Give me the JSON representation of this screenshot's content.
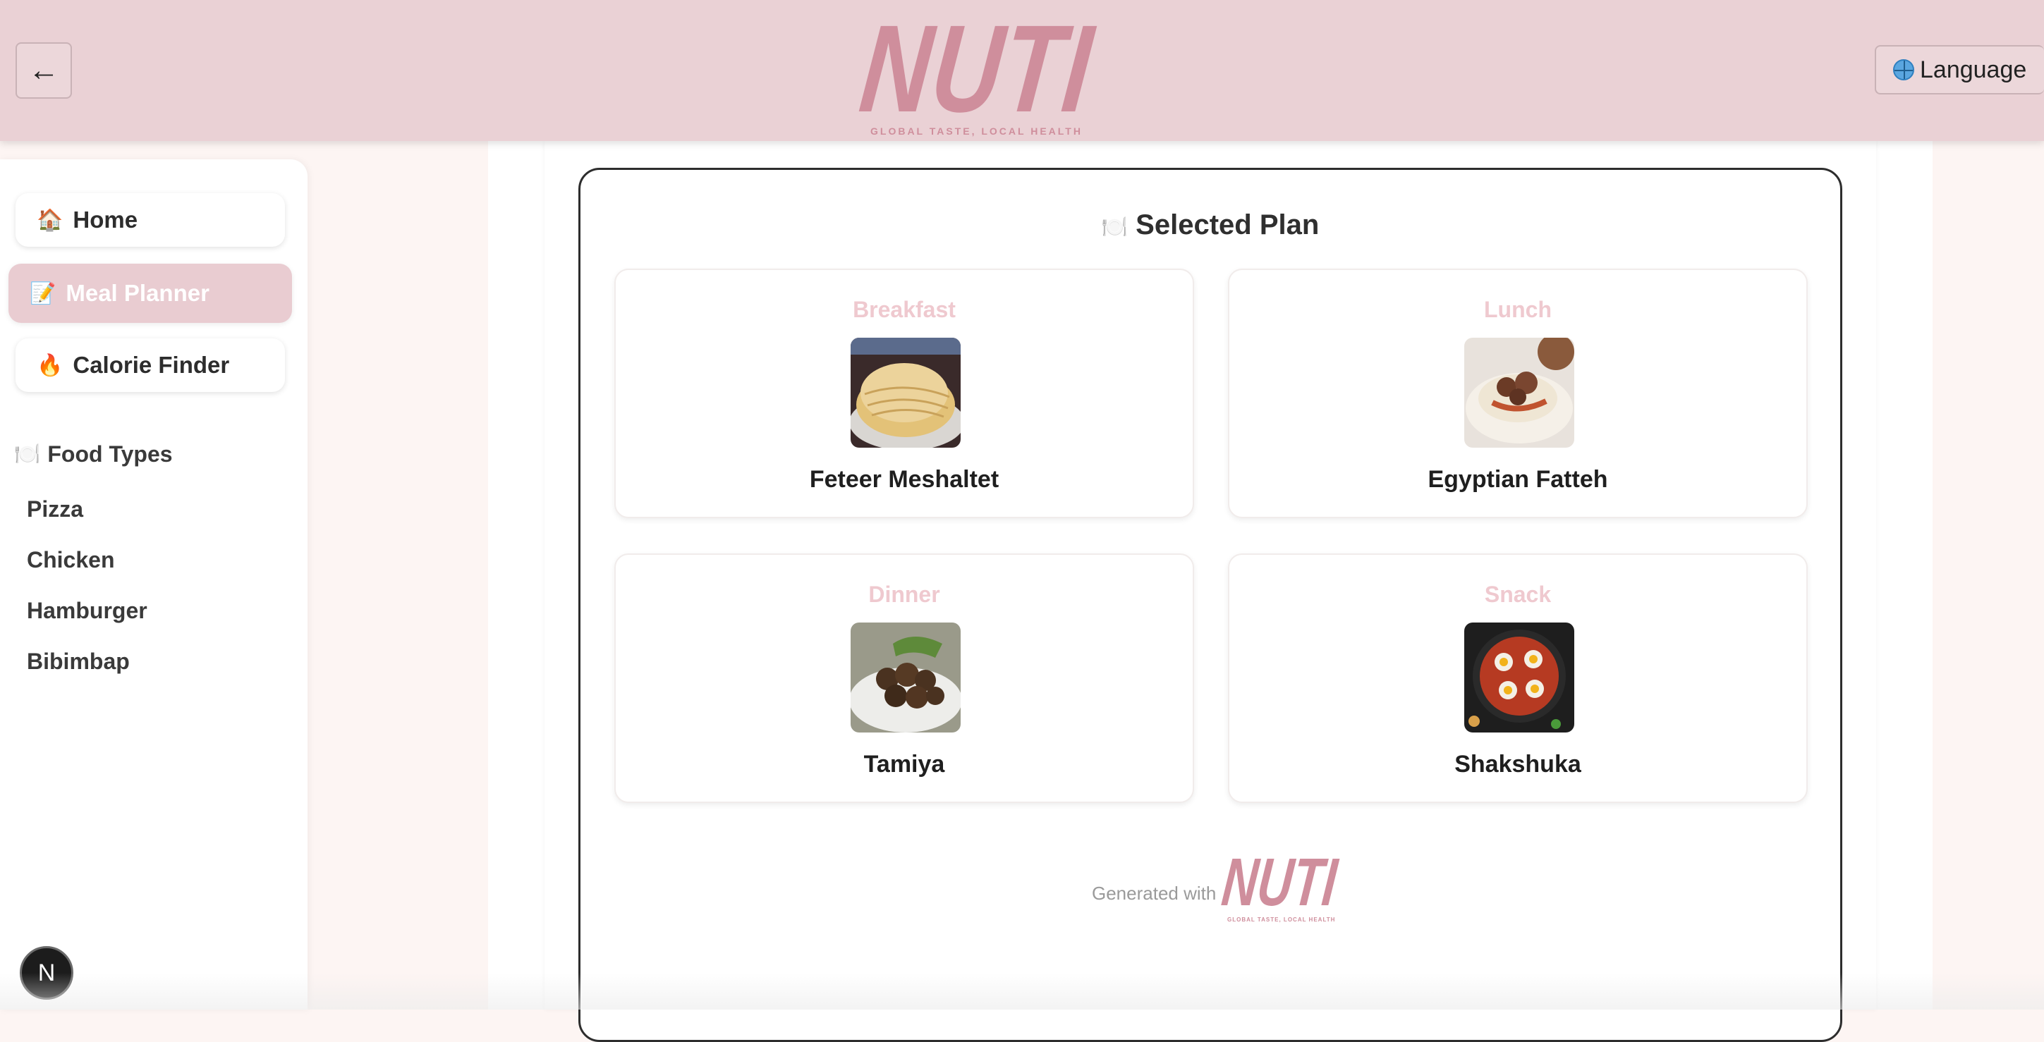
{
  "header": {
    "back_label": "←",
    "logo_text": "NUTI",
    "logo_tagline": "GLOBAL TASTE, LOCAL HEALTH",
    "language_label": "Language",
    "language_icon": "globe-icon"
  },
  "sidebar": {
    "nav": [
      {
        "icon": "🏠",
        "label": "Home"
      },
      {
        "icon": "📝",
        "label": "Meal Planner"
      },
      {
        "icon": "🔥",
        "label": "Calorie Finder"
      }
    ],
    "food_types_icon": "🍽️",
    "food_types_title": "Food Types",
    "food_types": [
      "Pizza",
      "Chicken",
      "Hamburger",
      "Bibimbap"
    ],
    "badge": "N"
  },
  "plan": {
    "icon": "🍽️",
    "title": "Selected Plan",
    "meals": [
      {
        "type": "Breakfast",
        "name": "Feteer Meshaltet"
      },
      {
        "type": "Lunch",
        "name": "Egyptian Fatteh"
      },
      {
        "type": "Dinner",
        "name": "Tamiya"
      },
      {
        "type": "Snack",
        "name": "Shakshuka"
      }
    ],
    "footer_text": "Generated with",
    "footer_logo": "NUTI",
    "footer_tagline": "GLOBAL TASTE, LOCAL HEALTH"
  },
  "colors": {
    "header_bg": "#ead1d5",
    "brand_pink": "#cf8e9c",
    "active_nav": "#e9ccd1",
    "meal_label": "#efc9cf",
    "page_bg": "#fdf5f3"
  }
}
